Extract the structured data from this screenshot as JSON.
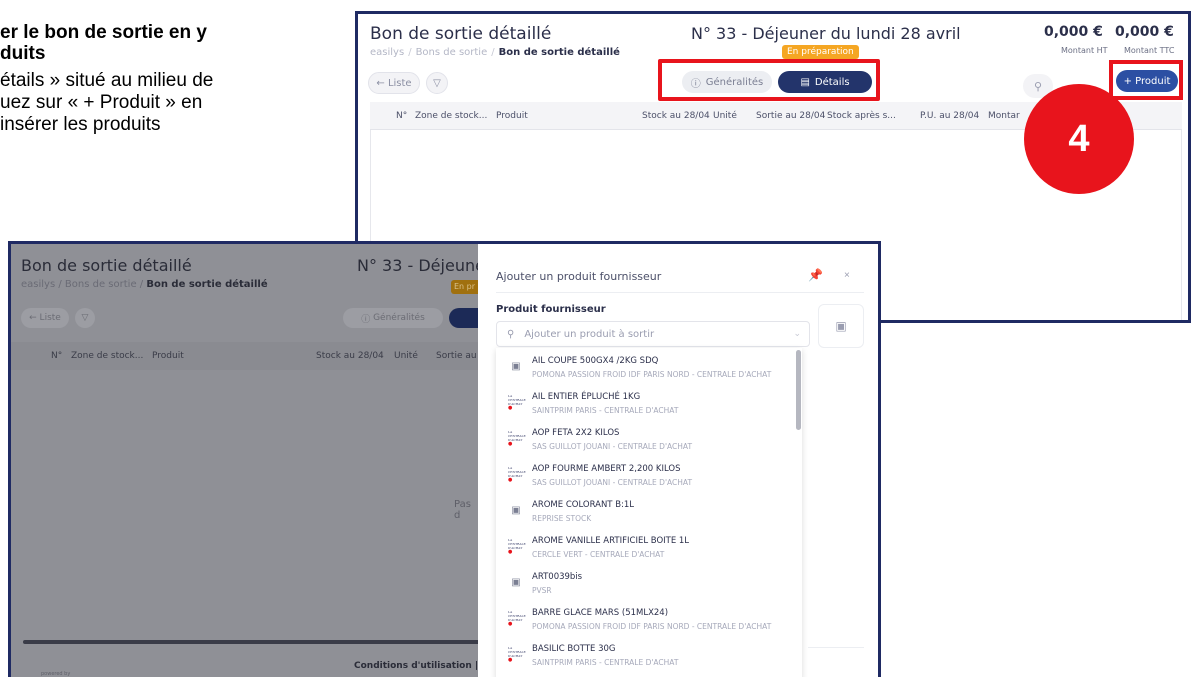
{
  "instructions": {
    "heading_line1": "er le bon de sortie en y",
    "heading_line2": "duits",
    "line1": "étails » situé au milieu de",
    "line2": "uez sur « + Produit » en",
    "line3": " insérer les produits"
  },
  "step_marker": "4",
  "top_screen": {
    "title": "Bon de sortie détaillé",
    "breadcrumb": [
      "easilys",
      "Bons de sortie",
      "Bon de sortie détaillé"
    ],
    "doc_title": "N° 33 - Déjeuner du lundi 28 avril",
    "status_badge": "En préparation",
    "amount_ht": "0,000 €",
    "amount_ttc": "0,000 €",
    "amount_ht_label": "Montant HT",
    "amount_ttc_label": "Montant TTC",
    "list_button": "← Liste",
    "filter_icon": "filter-icon",
    "tabs": [
      {
        "label": "Généralités",
        "icon": "info-icon"
      },
      {
        "label": "Détails",
        "icon": "list-icon"
      }
    ],
    "add_product_button": "+ Produit",
    "columns": [
      "N°",
      "Zone de stock...",
      "Produit",
      "Stock au 28/04",
      "Unité",
      "Sortie au 28/04",
      "Stock après s...",
      "P.U. au 28/04",
      "Montar"
    ]
  },
  "bottom_screen": {
    "title": "Bon de sortie détaillé",
    "breadcrumb": [
      "easilys",
      "Bons de sortie",
      "Bon de sortie détaillé"
    ],
    "doc_title": "N° 33 - Déjeune",
    "badge": "En pr",
    "list_button": "← Liste",
    "tab_generalites": "Généralités",
    "columns": [
      "N°",
      "Zone de stock...",
      "Produit",
      "Stock au 28/04",
      "Unité",
      "Sortie au"
    ],
    "empty_text": "Pas d",
    "footer_link": "Conditions d'utilisation  |  P",
    "powered_by": "powered by"
  },
  "panel": {
    "title": "Ajouter un produit fournisseur",
    "field_label": "Produit fournisseur",
    "search_placeholder": "Ajouter un produit à sortir",
    "items": [
      {
        "name": "AIL COUPE 500GX4 /2KG SDQ",
        "supplier": "POMONA PASSION FROID IDF PARIS NORD - CENTRALE D'ACHAT",
        "icon": "image"
      },
      {
        "name": "AIL ENTIER ÉPLUCHÉ 1KG",
        "supplier": "SAINTPRIM PARIS - CENTRALE D'ACHAT",
        "icon": "logo"
      },
      {
        "name": "AOP FETA 2X2 KILOS",
        "supplier": "SAS GUILLOT JOUANI - CENTRALE D'ACHAT",
        "icon": "logo"
      },
      {
        "name": "AOP FOURME AMBERT 2,200 KILOS",
        "supplier": "SAS GUILLOT JOUANI - CENTRALE D'ACHAT",
        "icon": "logo"
      },
      {
        "name": "AROME COLORANT B:1L",
        "supplier": "REPRISE STOCK",
        "icon": "image"
      },
      {
        "name": "AROME VANILLE ARTIFICIEL BOITE 1L",
        "supplier": "CERCLE VERT - CENTRALE D'ACHAT",
        "icon": "logo"
      },
      {
        "name": "ART0039bis",
        "supplier": "PVSR",
        "icon": "image"
      },
      {
        "name": "BARRE GLACE MARS (51MLX24)",
        "supplier": "POMONA PASSION FROID IDF PARIS NORD - CENTRALE D'ACHAT",
        "icon": "logo"
      },
      {
        "name": "BASILIC BOTTE 30G",
        "supplier": "SAINTPRIM PARIS - CENTRALE D'ACHAT",
        "icon": "logo"
      }
    ]
  }
}
